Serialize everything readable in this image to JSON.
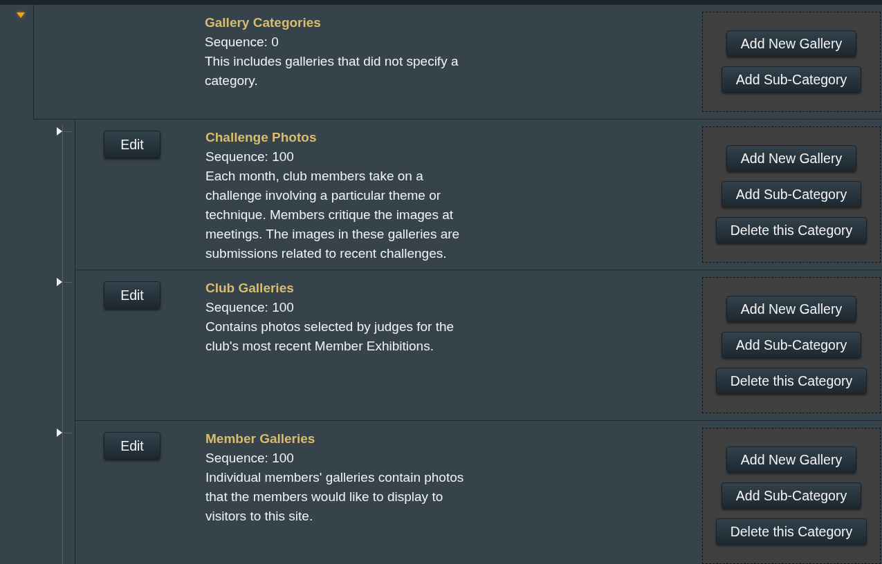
{
  "root": {
    "expanded": true,
    "title": "Gallery Categories",
    "sequence": "Sequence: 0",
    "description": "This includes galleries that did not specify a category.",
    "buttons": [
      "Add New Gallery",
      "Add Sub-Category"
    ],
    "children": [
      {
        "expanded": false,
        "edit": "Edit",
        "title": "Challenge Photos",
        "sequence": "Sequence: 100",
        "description": "Each month, club members take on a challenge involving a particular theme or technique. Members critique the images at meetings. The images in these galleries are submissions related to recent challenges.",
        "buttons": [
          "Add New Gallery",
          "Add Sub-Category",
          "Delete this Category"
        ]
      },
      {
        "expanded": false,
        "edit": "Edit",
        "title": "Club Galleries",
        "sequence": "Sequence: 100",
        "description": "Contains photos selected by judges for the club's most recent Member Exhibitions.",
        "buttons": [
          "Add New Gallery",
          "Add Sub-Category",
          "Delete this Category"
        ]
      },
      {
        "expanded": false,
        "edit": "Edit",
        "title": "Member Galleries",
        "sequence": "Sequence: 100",
        "description": "Individual members' galleries contain photos that the members would like to display to visitors to this site.",
        "buttons": [
          "Add New Gallery",
          "Add Sub-Category",
          "Delete this Category"
        ]
      }
    ]
  }
}
